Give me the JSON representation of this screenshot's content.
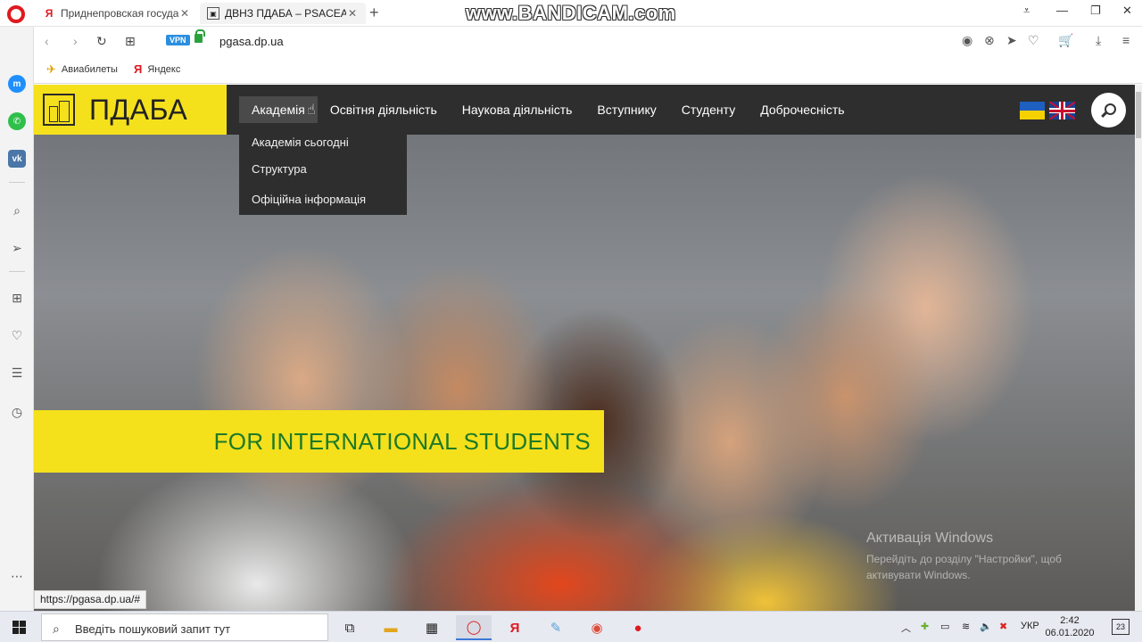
{
  "browser": {
    "tabs": [
      {
        "title": "Приднепровская государ",
        "favicon": "Я"
      },
      {
        "title": "ДВНЗ ПДАБА – PSACEA",
        "favicon": "▣"
      }
    ],
    "new_tab": "+",
    "watermark": "www.BANDICAM.com",
    "vpn_label": "VPN",
    "url": "pgasa.dp.ua",
    "bookmarks": [
      {
        "label": "Авиабилеты",
        "icon": "airplane-icon"
      },
      {
        "label": "Яндекс",
        "icon": "yandex-icon"
      }
    ],
    "status_url": "https://pgasa.dp.ua/#"
  },
  "site": {
    "logo_text": "ПДАБА",
    "menu": [
      {
        "label": "Академія",
        "active": true
      },
      {
        "label": "Освітня діяльність"
      },
      {
        "label": "Наукова діяльність"
      },
      {
        "label": "Вступнику"
      },
      {
        "label": "Студенту"
      },
      {
        "label": "Доброчесність"
      }
    ],
    "dropdown": [
      "Академія сьогодні",
      "Структура",
      "Офіційна інформація"
    ],
    "banner": "FOR INTERNATIONAL STUDENTS",
    "colors": {
      "brand_yellow": "#f5e01c",
      "banner_text": "#1c7a27",
      "header": "#2e2e2e"
    }
  },
  "windows": {
    "activation_title": "Активація Windows",
    "activation_sub": "Перейдіть до розділу \"Настройки\", щоб активувати Windows.",
    "search_placeholder": "Введіть пошуковий запит тут",
    "lang": "УКР",
    "time": "2:42",
    "date": "06.01.2020",
    "notifications": "23"
  }
}
